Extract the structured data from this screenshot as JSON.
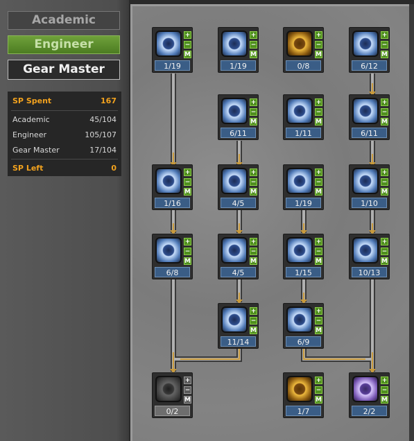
{
  "tabs": [
    {
      "label": "Academic",
      "state": "inactive"
    },
    {
      "label": "Engineer",
      "state": "highlighted"
    },
    {
      "label": "Gear Master",
      "state": "selected"
    }
  ],
  "stats": {
    "sp_spent_label": "SP Spent",
    "sp_spent_value": "167",
    "rows": [
      {
        "label": "Academic",
        "value": "45/104"
      },
      {
        "label": "Engineer",
        "value": "105/107"
      },
      {
        "label": "Gear Master",
        "value": "17/104"
      }
    ],
    "sp_left_label": "SP Left",
    "sp_left_value": "0"
  },
  "skill_buttons": {
    "plus": "+",
    "minus": "−",
    "max": "M"
  },
  "skills": [
    {
      "id": "s1",
      "level": "1/19"
    },
    {
      "id": "s2",
      "level": "1/19"
    },
    {
      "id": "s3",
      "level": "0/8"
    },
    {
      "id": "s4",
      "level": "6/12"
    },
    {
      "id": "s5",
      "level": "6/11"
    },
    {
      "id": "s6",
      "level": "1/11"
    },
    {
      "id": "s7",
      "level": "6/11"
    },
    {
      "id": "s8",
      "level": "1/16"
    },
    {
      "id": "s9",
      "level": "4/5"
    },
    {
      "id": "s10",
      "level": "1/19"
    },
    {
      "id": "s11",
      "level": "1/10"
    },
    {
      "id": "s12",
      "level": "6/8"
    },
    {
      "id": "s13",
      "level": "4/5"
    },
    {
      "id": "s14",
      "level": "1/15"
    },
    {
      "id": "s15",
      "level": "10/13"
    },
    {
      "id": "s16",
      "level": "11/14"
    },
    {
      "id": "s17",
      "level": "6/9"
    },
    {
      "id": "s18",
      "level": "0/2"
    },
    {
      "id": "s19",
      "level": "1/7"
    },
    {
      "id": "s20",
      "level": "2/2"
    }
  ]
}
